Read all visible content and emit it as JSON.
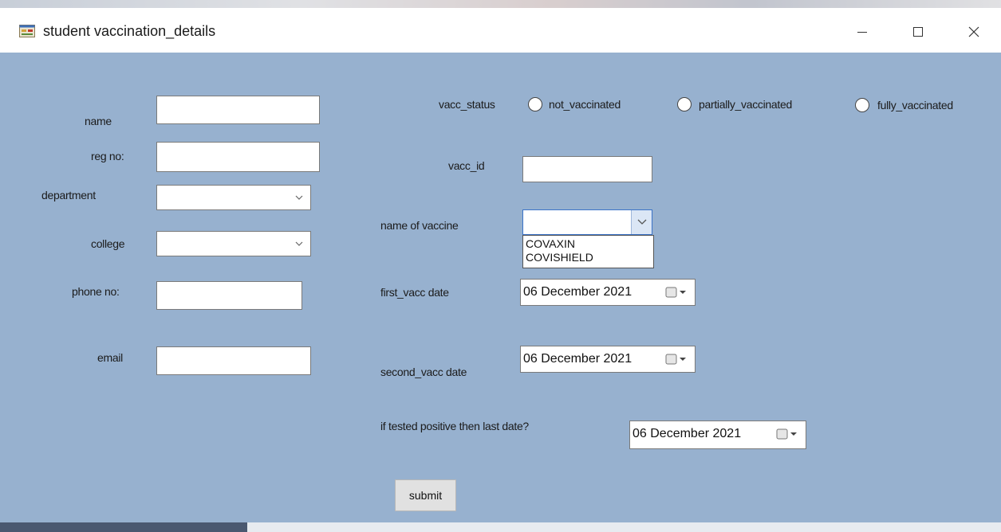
{
  "window": {
    "title": "student vaccination_details",
    "icon": "windows-form-icon"
  },
  "form": {
    "left": {
      "name_label": "name",
      "name_value": "",
      "regno_label": "reg no:",
      "regno_value": "",
      "department_label": "department",
      "department_value": "",
      "college_label": "college",
      "college_value": "",
      "phone_label": "phone no:",
      "phone_value": "",
      "email_label": "email",
      "email_value": ""
    },
    "vacc_status": {
      "label": "vacc_status",
      "options": [
        "not_vaccinated",
        "partially_vaccinated",
        "fully_vaccinated"
      ],
      "selected": null
    },
    "vacc_id": {
      "label": "vacc_id",
      "value": ""
    },
    "vaccine": {
      "label": "name of vaccine",
      "value": "",
      "options": [
        "COVAXIN",
        "COVISHIELD"
      ],
      "expanded": true
    },
    "first_vacc": {
      "label": "first_vacc date",
      "value": "06 December 2021"
    },
    "second_vacc": {
      "label": "second_vacc date",
      "value": "06 December 2021"
    },
    "positive": {
      "label": "if tested positive then last date?",
      "value": "06 December 2021"
    },
    "submit_label": "submit"
  },
  "colors": {
    "client_background": "#97b1cf",
    "titlebar_background": "#ffffff",
    "button_background": "#e1e1e1"
  }
}
